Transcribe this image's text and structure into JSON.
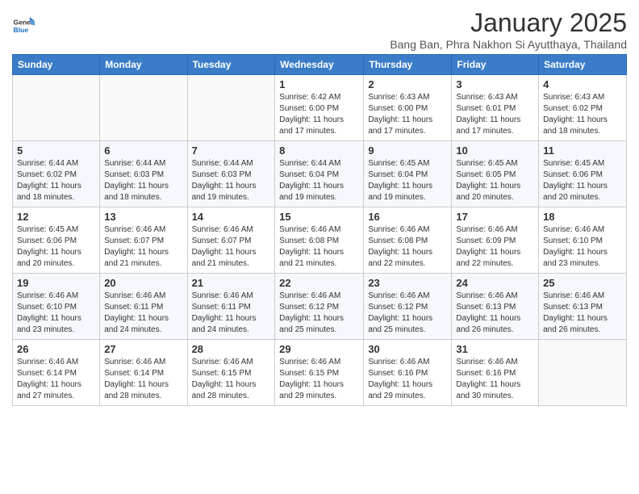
{
  "header": {
    "logo_general": "General",
    "logo_blue": "Blue",
    "month_title": "January 2025",
    "location": "Bang Ban, Phra Nakhon Si Ayutthaya, Thailand"
  },
  "days_of_week": [
    "Sunday",
    "Monday",
    "Tuesday",
    "Wednesday",
    "Thursday",
    "Friday",
    "Saturday"
  ],
  "weeks": [
    [
      {
        "day": "",
        "info": ""
      },
      {
        "day": "",
        "info": ""
      },
      {
        "day": "",
        "info": ""
      },
      {
        "day": "1",
        "info": "Sunrise: 6:42 AM\nSunset: 6:00 PM\nDaylight: 11 hours and 17 minutes."
      },
      {
        "day": "2",
        "info": "Sunrise: 6:43 AM\nSunset: 6:00 PM\nDaylight: 11 hours and 17 minutes."
      },
      {
        "day": "3",
        "info": "Sunrise: 6:43 AM\nSunset: 6:01 PM\nDaylight: 11 hours and 17 minutes."
      },
      {
        "day": "4",
        "info": "Sunrise: 6:43 AM\nSunset: 6:02 PM\nDaylight: 11 hours and 18 minutes."
      }
    ],
    [
      {
        "day": "5",
        "info": "Sunrise: 6:44 AM\nSunset: 6:02 PM\nDaylight: 11 hours and 18 minutes."
      },
      {
        "day": "6",
        "info": "Sunrise: 6:44 AM\nSunset: 6:03 PM\nDaylight: 11 hours and 18 minutes."
      },
      {
        "day": "7",
        "info": "Sunrise: 6:44 AM\nSunset: 6:03 PM\nDaylight: 11 hours and 19 minutes."
      },
      {
        "day": "8",
        "info": "Sunrise: 6:44 AM\nSunset: 6:04 PM\nDaylight: 11 hours and 19 minutes."
      },
      {
        "day": "9",
        "info": "Sunrise: 6:45 AM\nSunset: 6:04 PM\nDaylight: 11 hours and 19 minutes."
      },
      {
        "day": "10",
        "info": "Sunrise: 6:45 AM\nSunset: 6:05 PM\nDaylight: 11 hours and 20 minutes."
      },
      {
        "day": "11",
        "info": "Sunrise: 6:45 AM\nSunset: 6:06 PM\nDaylight: 11 hours and 20 minutes."
      }
    ],
    [
      {
        "day": "12",
        "info": "Sunrise: 6:45 AM\nSunset: 6:06 PM\nDaylight: 11 hours and 20 minutes."
      },
      {
        "day": "13",
        "info": "Sunrise: 6:46 AM\nSunset: 6:07 PM\nDaylight: 11 hours and 21 minutes."
      },
      {
        "day": "14",
        "info": "Sunrise: 6:46 AM\nSunset: 6:07 PM\nDaylight: 11 hours and 21 minutes."
      },
      {
        "day": "15",
        "info": "Sunrise: 6:46 AM\nSunset: 6:08 PM\nDaylight: 11 hours and 21 minutes."
      },
      {
        "day": "16",
        "info": "Sunrise: 6:46 AM\nSunset: 6:08 PM\nDaylight: 11 hours and 22 minutes."
      },
      {
        "day": "17",
        "info": "Sunrise: 6:46 AM\nSunset: 6:09 PM\nDaylight: 11 hours and 22 minutes."
      },
      {
        "day": "18",
        "info": "Sunrise: 6:46 AM\nSunset: 6:10 PM\nDaylight: 11 hours and 23 minutes."
      }
    ],
    [
      {
        "day": "19",
        "info": "Sunrise: 6:46 AM\nSunset: 6:10 PM\nDaylight: 11 hours and 23 minutes."
      },
      {
        "day": "20",
        "info": "Sunrise: 6:46 AM\nSunset: 6:11 PM\nDaylight: 11 hours and 24 minutes."
      },
      {
        "day": "21",
        "info": "Sunrise: 6:46 AM\nSunset: 6:11 PM\nDaylight: 11 hours and 24 minutes."
      },
      {
        "day": "22",
        "info": "Sunrise: 6:46 AM\nSunset: 6:12 PM\nDaylight: 11 hours and 25 minutes."
      },
      {
        "day": "23",
        "info": "Sunrise: 6:46 AM\nSunset: 6:12 PM\nDaylight: 11 hours and 25 minutes."
      },
      {
        "day": "24",
        "info": "Sunrise: 6:46 AM\nSunset: 6:13 PM\nDaylight: 11 hours and 26 minutes."
      },
      {
        "day": "25",
        "info": "Sunrise: 6:46 AM\nSunset: 6:13 PM\nDaylight: 11 hours and 26 minutes."
      }
    ],
    [
      {
        "day": "26",
        "info": "Sunrise: 6:46 AM\nSunset: 6:14 PM\nDaylight: 11 hours and 27 minutes."
      },
      {
        "day": "27",
        "info": "Sunrise: 6:46 AM\nSunset: 6:14 PM\nDaylight: 11 hours and 28 minutes."
      },
      {
        "day": "28",
        "info": "Sunrise: 6:46 AM\nSunset: 6:15 PM\nDaylight: 11 hours and 28 minutes."
      },
      {
        "day": "29",
        "info": "Sunrise: 6:46 AM\nSunset: 6:15 PM\nDaylight: 11 hours and 29 minutes."
      },
      {
        "day": "30",
        "info": "Sunrise: 6:46 AM\nSunset: 6:16 PM\nDaylight: 11 hours and 29 minutes."
      },
      {
        "day": "31",
        "info": "Sunrise: 6:46 AM\nSunset: 6:16 PM\nDaylight: 11 hours and 30 minutes."
      },
      {
        "day": "",
        "info": ""
      }
    ]
  ]
}
